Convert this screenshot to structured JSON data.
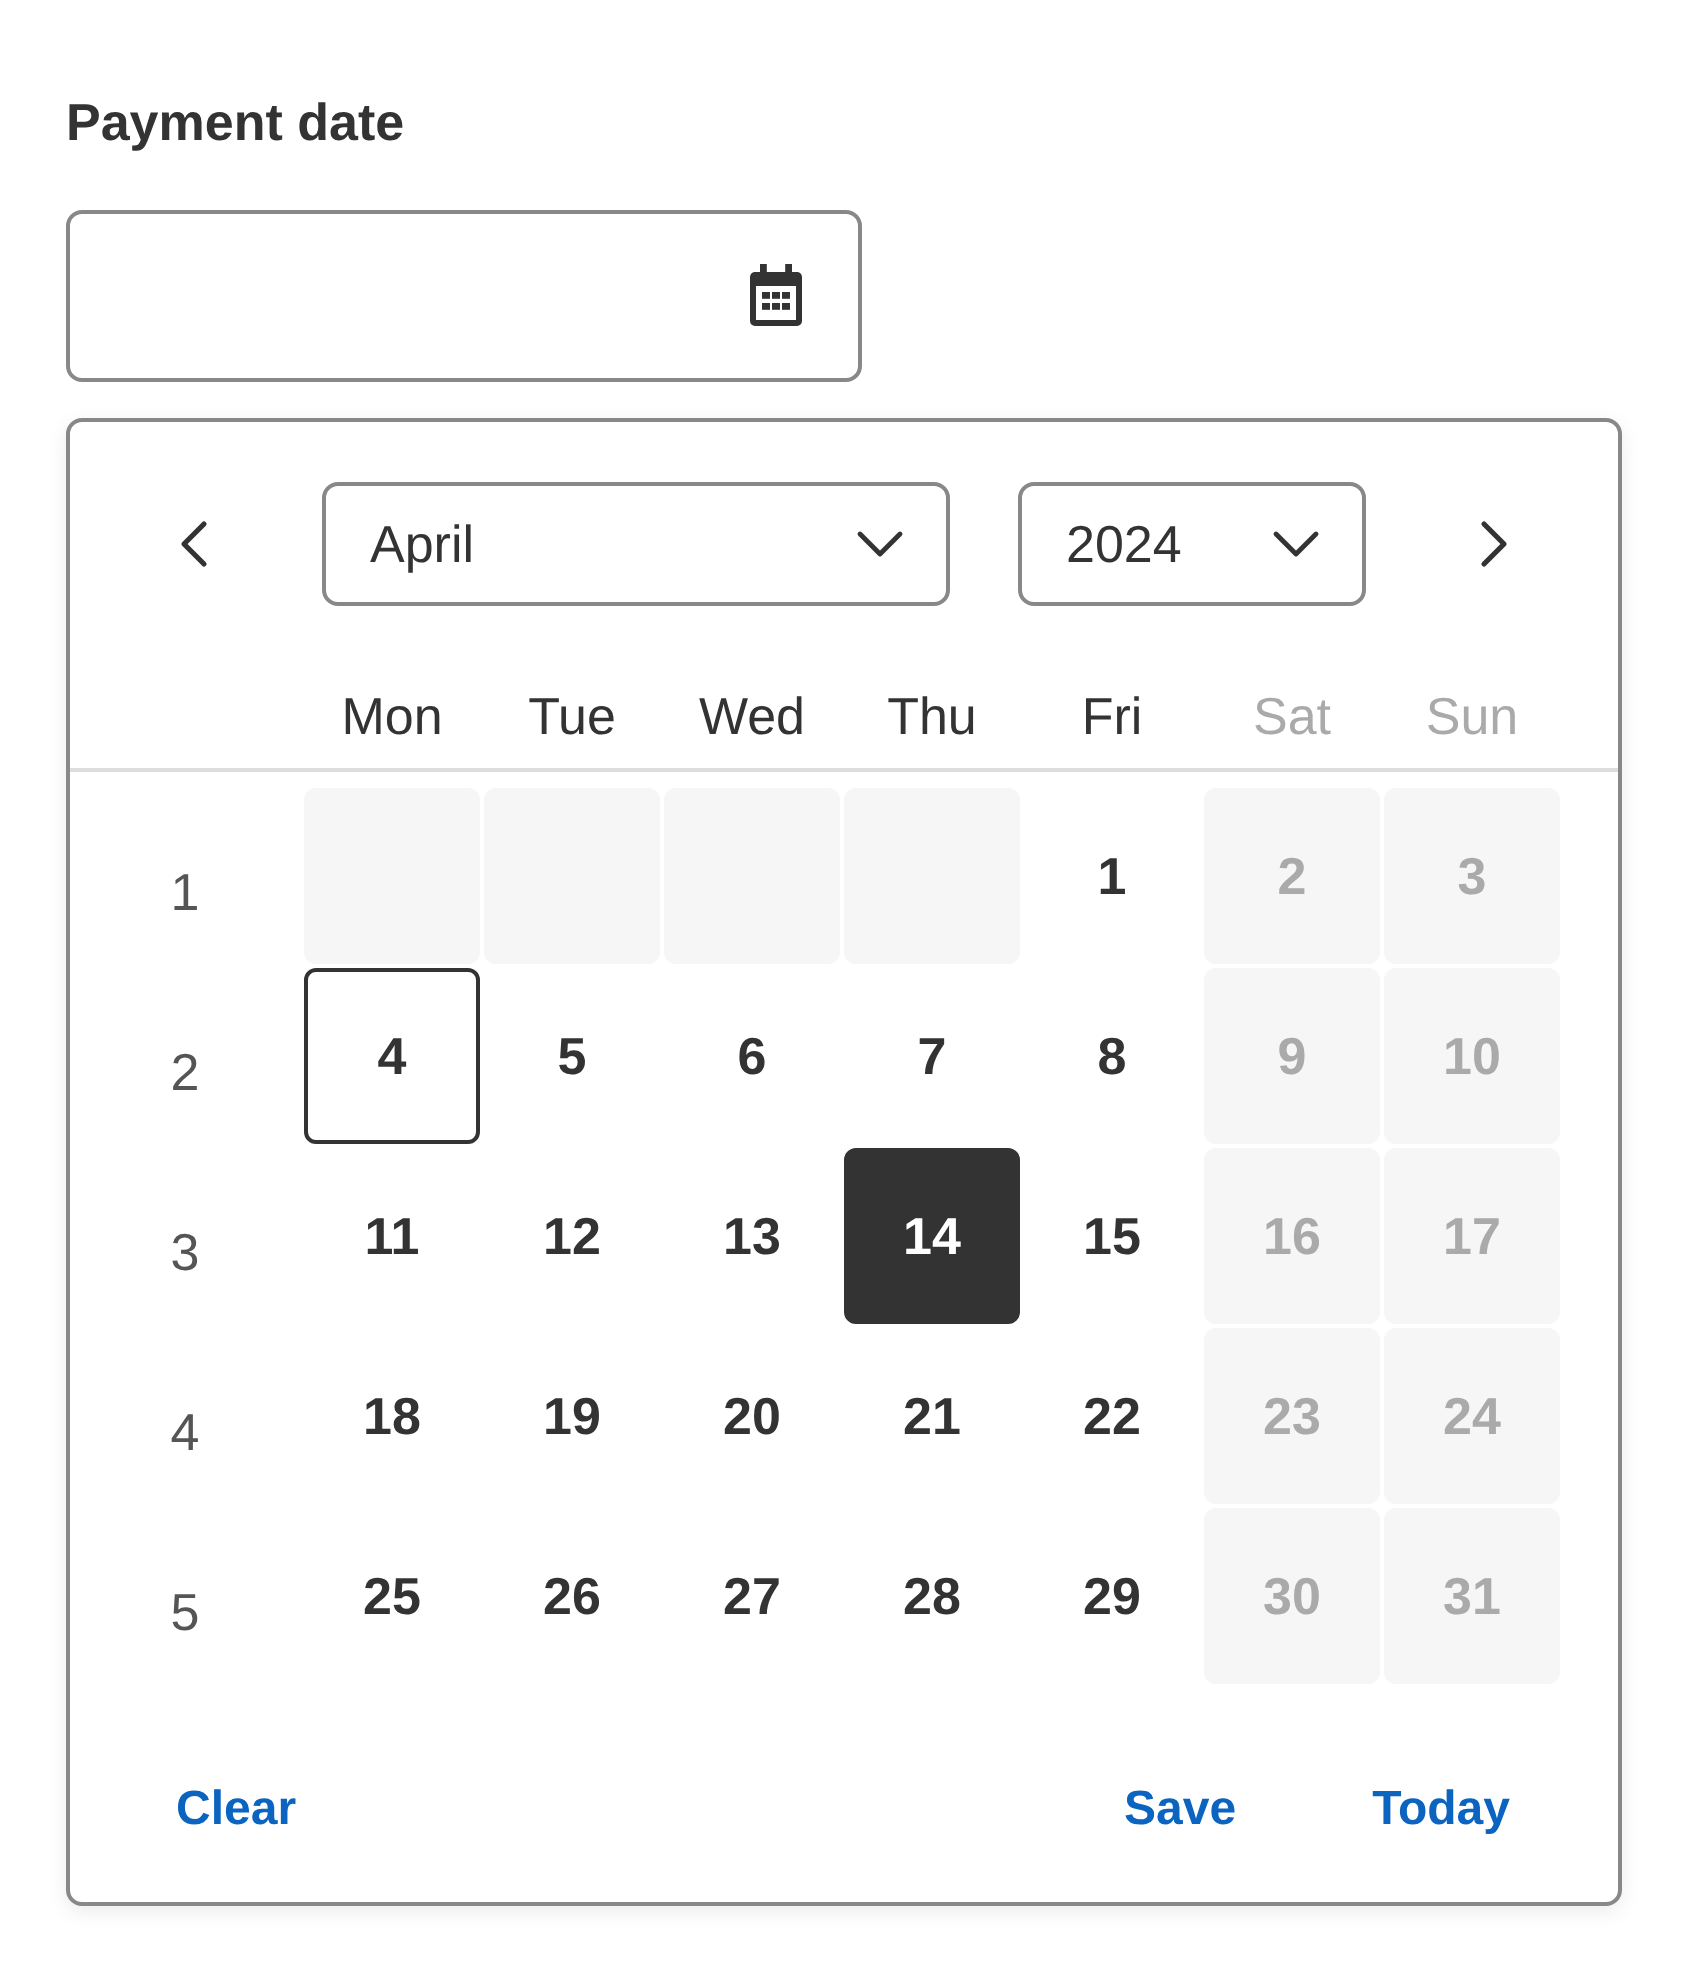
{
  "date_field": {
    "label": "Payment date"
  },
  "picker": {
    "month_select": {
      "value": "April"
    },
    "year_select": {
      "value": "2024"
    },
    "weekdays": [
      {
        "text": "Mon",
        "dimmed": false
      },
      {
        "text": "Tue",
        "dimmed": false
      },
      {
        "text": "Wed",
        "dimmed": false
      },
      {
        "text": "Thu",
        "dimmed": false
      },
      {
        "text": "Fri",
        "dimmed": false
      },
      {
        "text": "Sat",
        "dimmed": true
      },
      {
        "text": "Sun",
        "dimmed": true
      }
    ],
    "weeks": [
      {
        "number": "1",
        "days": [
          {
            "kind": "blank"
          },
          {
            "kind": "blank"
          },
          {
            "kind": "blank"
          },
          {
            "kind": "blank"
          },
          {
            "kind": "day",
            "text": "1",
            "selected": false,
            "disabled": false,
            "today": false
          },
          {
            "kind": "day",
            "text": "2",
            "selected": false,
            "disabled": true,
            "today": false
          },
          {
            "kind": "day",
            "text": "3",
            "selected": false,
            "disabled": true,
            "today": false
          }
        ]
      },
      {
        "number": "2",
        "days": [
          {
            "kind": "day",
            "text": "4",
            "selected": false,
            "disabled": false,
            "today": true
          },
          {
            "kind": "day",
            "text": "5",
            "selected": false,
            "disabled": false,
            "today": false
          },
          {
            "kind": "day",
            "text": "6",
            "selected": false,
            "disabled": false,
            "today": false
          },
          {
            "kind": "day",
            "text": "7",
            "selected": false,
            "disabled": false,
            "today": false
          },
          {
            "kind": "day",
            "text": "8",
            "selected": false,
            "disabled": false,
            "today": false
          },
          {
            "kind": "day",
            "text": "9",
            "selected": false,
            "disabled": true,
            "today": false
          },
          {
            "kind": "day",
            "text": "10",
            "selected": false,
            "disabled": true,
            "today": false
          }
        ]
      },
      {
        "number": "3",
        "days": [
          {
            "kind": "day",
            "text": "11",
            "selected": false,
            "disabled": false,
            "today": false
          },
          {
            "kind": "day",
            "text": "12",
            "selected": false,
            "disabled": false,
            "today": false
          },
          {
            "kind": "day",
            "text": "13",
            "selected": false,
            "disabled": false,
            "today": false
          },
          {
            "kind": "day",
            "text": "14",
            "selected": true,
            "disabled": false,
            "today": false
          },
          {
            "kind": "day",
            "text": "15",
            "selected": false,
            "disabled": false,
            "today": false
          },
          {
            "kind": "day",
            "text": "16",
            "selected": false,
            "disabled": true,
            "today": false
          },
          {
            "kind": "day",
            "text": "17",
            "selected": false,
            "disabled": true,
            "today": false
          }
        ]
      },
      {
        "number": "4",
        "days": [
          {
            "kind": "day",
            "text": "18",
            "selected": false,
            "disabled": false,
            "today": false
          },
          {
            "kind": "day",
            "text": "19",
            "selected": false,
            "disabled": false,
            "today": false
          },
          {
            "kind": "day",
            "text": "20",
            "selected": false,
            "disabled": false,
            "today": false
          },
          {
            "kind": "day",
            "text": "21",
            "selected": false,
            "disabled": false,
            "today": false
          },
          {
            "kind": "day",
            "text": "22",
            "selected": false,
            "disabled": false,
            "today": false
          },
          {
            "kind": "day",
            "text": "23",
            "selected": false,
            "disabled": true,
            "today": false
          },
          {
            "kind": "day",
            "text": "24",
            "selected": false,
            "disabled": true,
            "today": false
          }
        ]
      },
      {
        "number": "5",
        "days": [
          {
            "kind": "day",
            "text": "25",
            "selected": false,
            "disabled": false,
            "today": false
          },
          {
            "kind": "day",
            "text": "26",
            "selected": false,
            "disabled": false,
            "today": false
          },
          {
            "kind": "day",
            "text": "27",
            "selected": false,
            "disabled": false,
            "today": false
          },
          {
            "kind": "day",
            "text": "28",
            "selected": false,
            "disabled": false,
            "today": false
          },
          {
            "kind": "day",
            "text": "29",
            "selected": false,
            "disabled": false,
            "today": false
          },
          {
            "kind": "day",
            "text": "30",
            "selected": false,
            "disabled": true,
            "today": false
          },
          {
            "kind": "day",
            "text": "31",
            "selected": false,
            "disabled": true,
            "today": false
          }
        ]
      }
    ],
    "actions": [
      {
        "text": "Clear"
      },
      {
        "text": "Save"
      },
      {
        "text": "Today"
      }
    ]
  }
}
